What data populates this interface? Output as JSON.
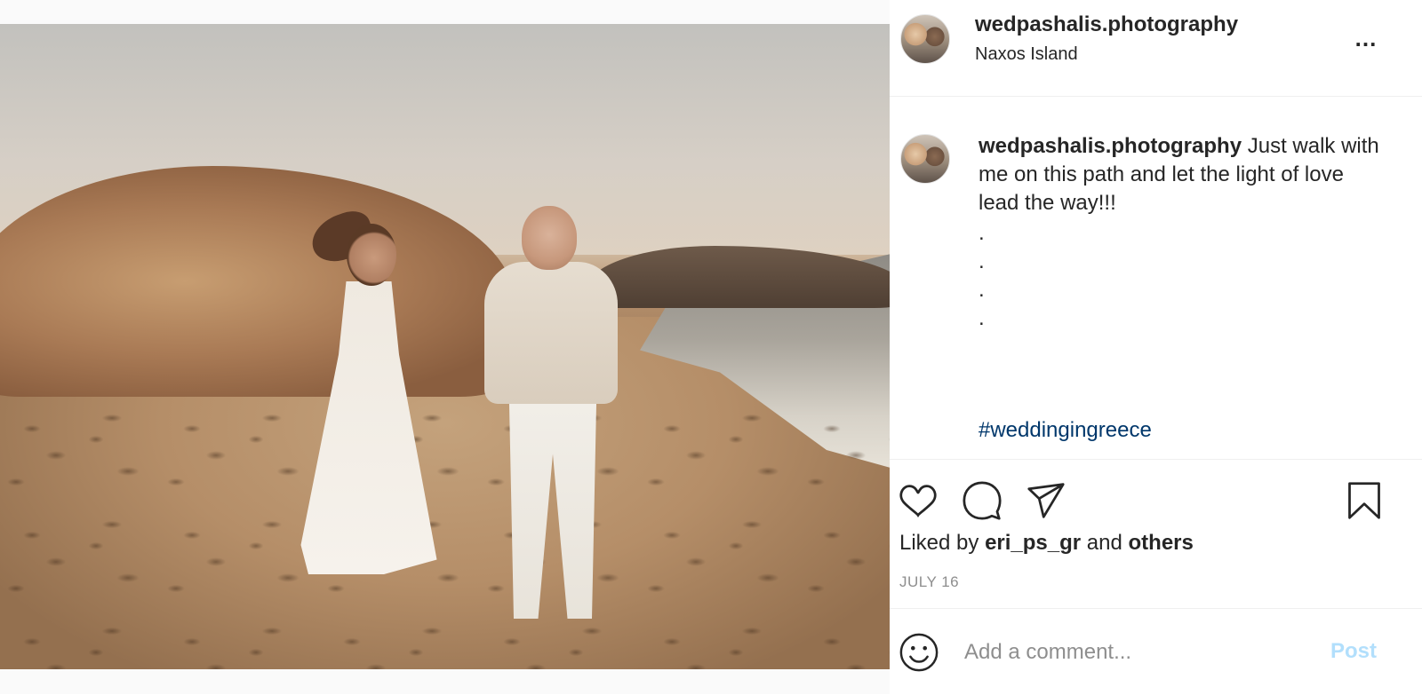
{
  "post": {
    "username": "wedpashalis.photography",
    "location": "Naxos Island",
    "more_label": "...",
    "photo_alt": "Bride and groom walking hand in hand on a sandy beach at sunset"
  },
  "caption": {
    "username": "wedpashalis.photography",
    "text": " Just walk with me on this path and let the light of love lead the way!!!",
    "dots": [
      ".",
      ".",
      ".",
      "."
    ],
    "hashtag": "#weddingingreece"
  },
  "actions": {
    "icons": [
      "heart-icon",
      "comment-icon",
      "paper-plane-icon",
      "bookmark-icon"
    ],
    "liked_by_prefix": "Liked by ",
    "liked_by_user": "eri_ps_gr",
    "liked_by_and": " and ",
    "liked_by_others": "others",
    "date": "JULY 16"
  },
  "comment": {
    "placeholder": "Add a comment...",
    "post_label": "Post",
    "icon": "smiley-icon"
  },
  "colors": {
    "text": "#262626",
    "muted": "#8e8e8e",
    "hashtag": "#00376b",
    "post_disabled": "#b2dffc",
    "divider": "#efefef"
  }
}
